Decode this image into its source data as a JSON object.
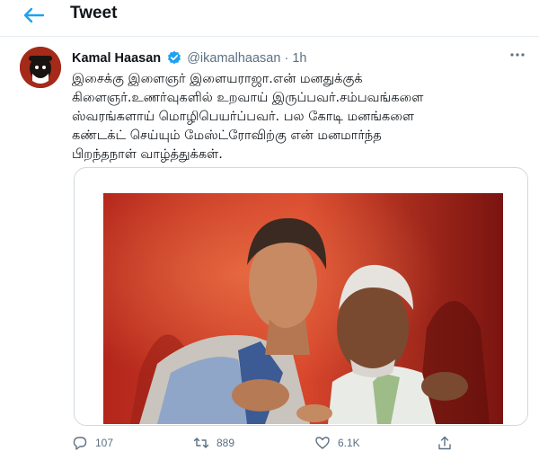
{
  "header": {
    "title": "Tweet",
    "back_icon": "arrow-left-icon"
  },
  "tweet": {
    "author_name": "Kamal Haasan",
    "handle": "@ikamalhaasan",
    "separator": "·",
    "time": "1h",
    "text": "இசைக்கு இளைஞர் இளையராஜா.என் மனதுக்குக்\nகிளைஞர்.உணர்வுகளில் உறவாய் இருப்பவர்.சம்பவங்களை\nஸ்வரங்களாய் மொழிபெயர்ப்பவர். பல கோடி மனங்களை\nகண்டக்ட் செய்யும் மேஸ்ட்ரோவிற்கு என் மனமார்ந்த\nபிறந்தநாள் வாழ்த்துக்கள்."
  },
  "actions": {
    "reply_count": "107",
    "retweet_count": "889",
    "like_count": "6.1K"
  },
  "colors": {
    "accent": "#1da1f2",
    "muted": "#5b7083",
    "border": "#e6ecf0"
  }
}
